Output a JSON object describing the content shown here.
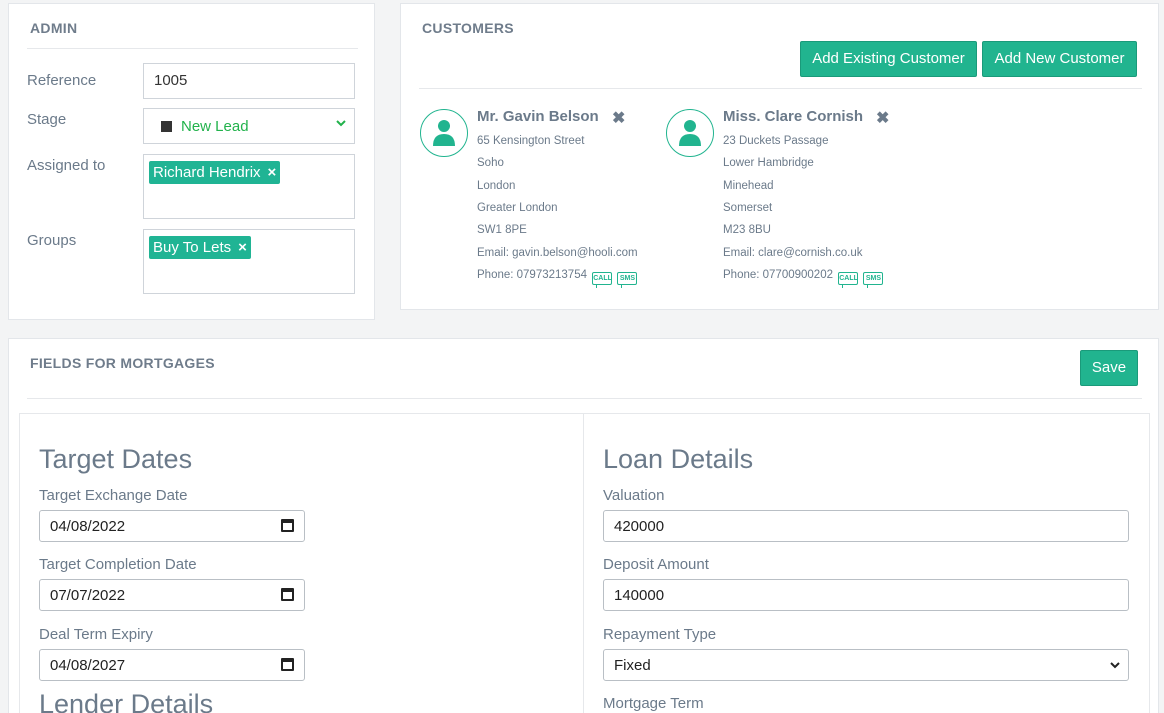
{
  "admin": {
    "title": "ADMIN",
    "reference_label": "Reference",
    "reference_value": "1005",
    "stage_label": "Stage",
    "stage_value": "New Lead",
    "assigned_label": "Assigned to",
    "assigned_tag": "Richard Hendrix",
    "groups_label": "Groups",
    "groups_tag": "Buy To Lets",
    "tag_remove": "×"
  },
  "customers": {
    "title": "CUSTOMERS",
    "add_existing": "Add Existing Customer",
    "add_new": "Add New Customer",
    "list": [
      {
        "name": "Mr. Gavin Belson",
        "lines": [
          "65 Kensington Street",
          "Soho",
          "London",
          "Greater London",
          "SW1 8PE",
          "Email: gavin.belson@hooli.com"
        ],
        "phone": "Phone: 07973213754"
      },
      {
        "name": "Miss. Clare Cornish",
        "lines": [
          "23 Duckets Passage",
          "Lower Hambridge",
          "Minehead",
          "Somerset",
          "M23 8BU",
          "Email: clare@cornish.co.uk"
        ],
        "phone": "Phone: 07700900202"
      }
    ],
    "remove_icon": "✖",
    "call_label": "CALL",
    "sms_label": "SMS"
  },
  "mortgages": {
    "title": "FIELDS FOR MORTGAGES",
    "save": "Save",
    "target_dates": {
      "heading": "Target Dates",
      "exchange_label": "Target Exchange Date",
      "exchange_value": "04/08/2022",
      "completion_label": "Target Completion Date",
      "completion_value": "07/07/2022",
      "expiry_label": "Deal Term Expiry",
      "expiry_value": "04/08/2027"
    },
    "lender_heading": "Lender Details",
    "loan_details": {
      "heading": "Loan Details",
      "valuation_label": "Valuation",
      "valuation_value": "420000",
      "deposit_label": "Deposit Amount",
      "deposit_value": "140000",
      "repayment_label": "Repayment Type",
      "repayment_value": "Fixed",
      "term_label": "Mortgage Term"
    }
  },
  "colors": {
    "accent": "#21b48f",
    "stage_green": "#22b24c"
  }
}
